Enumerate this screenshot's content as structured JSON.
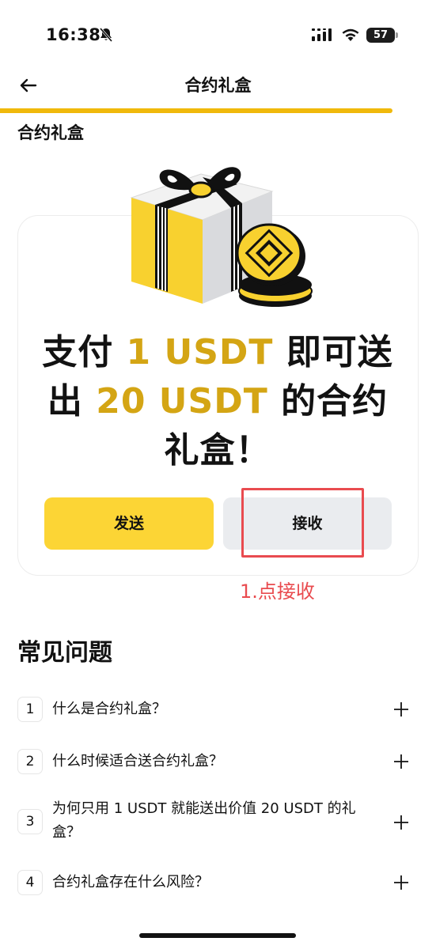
{
  "status_bar": {
    "time": "16:38",
    "battery": "57"
  },
  "nav": {
    "title": "合约礼盒",
    "progress": 0.9
  },
  "section": {
    "title": "合约礼盒"
  },
  "headline": {
    "part1": "支付 ",
    "accent1": "1 USDT",
    "part2": " 即可送出 ",
    "accent2": "20 USDT",
    "part3": " 的合约礼盒！"
  },
  "buttons": {
    "send": "发送",
    "receive": "接收"
  },
  "annotation": "1.点接收",
  "faq": {
    "title": "常见问题",
    "items": [
      {
        "num": "1",
        "question": "什么是合约礼盒？"
      },
      {
        "num": "2",
        "question": "什么时候适合送合约礼盒？"
      },
      {
        "num": "3",
        "question": "为何只用 1 USDT 就能送出价值 20 USDT 的礼盒？"
      },
      {
        "num": "4",
        "question": "合约礼盒存在什么风险？"
      }
    ]
  },
  "colors": {
    "brand_yellow": "#fcd535",
    "accent_text": "#d4a514",
    "annotation_red": "#e94b4f",
    "progress": "#f0b90b"
  },
  "icons": [
    "bell-off-icon",
    "signal-icon",
    "wifi-icon",
    "battery-icon",
    "back-arrow-icon",
    "gift-box-icon",
    "plus-icon"
  ]
}
